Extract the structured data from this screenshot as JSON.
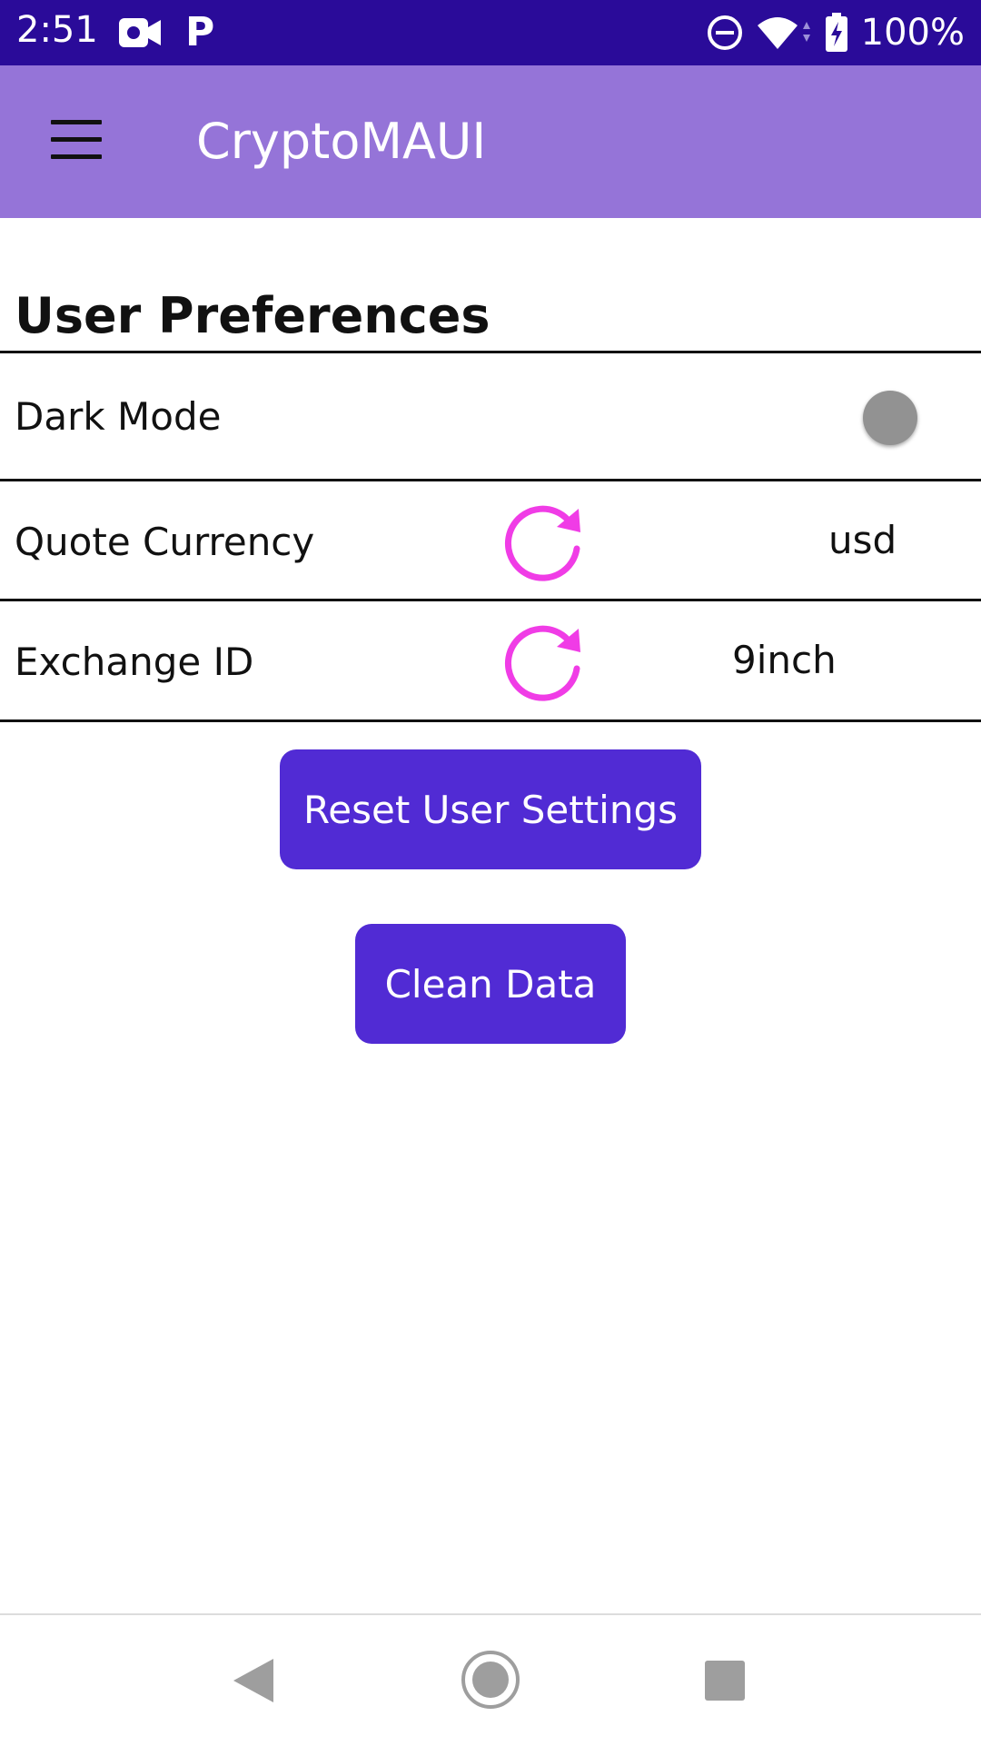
{
  "status_bar": {
    "time": "2:51",
    "p_glyph": "P",
    "battery_text": "100%",
    "icons": [
      "video-camera-icon",
      "dnd-icon",
      "wifi-icon",
      "battery-charging-icon"
    ]
  },
  "app_bar": {
    "title": "CryptoMAUI",
    "menu_icon": "hamburger-menu-icon",
    "background": "#9574d8"
  },
  "section": {
    "title": "User Preferences"
  },
  "rows": [
    {
      "label": "Dark Mode",
      "control": "toggle",
      "toggle_on": false
    },
    {
      "label": "Quote Currency",
      "value": "usd",
      "icon": "refresh-icon"
    },
    {
      "label": "Exchange ID",
      "value": "9inch",
      "icon": "refresh-icon"
    }
  ],
  "buttons": {
    "reset": "Reset User Settings",
    "clean": "Clean Data",
    "color": "#512bd4"
  },
  "refresh_icon_color": "#f03ce6",
  "nav_bar": {
    "icons": [
      "back-icon",
      "home-icon",
      "recents-icon"
    ]
  }
}
